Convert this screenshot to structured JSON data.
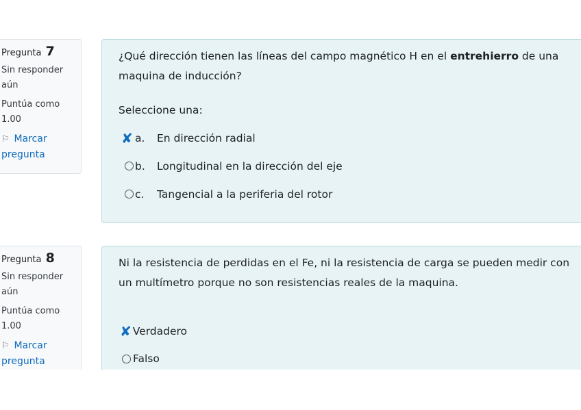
{
  "questions": [
    {
      "label": "Pregunta",
      "number": "7",
      "state": "Sin responder aún",
      "grade": "Puntúa como 1.00",
      "flag_label": "Marcar pregunta",
      "text_before": "¿Qué dirección tienen las líneas del campo magnético H en el ",
      "text_bold": "entrehierro",
      "text_after": " de una maquina de inducción?",
      "prompt": "Seleccione una:",
      "options": [
        {
          "letter": "a.",
          "text": "En dirección radial",
          "marked": true
        },
        {
          "letter": "b.",
          "text": "Longitudinal en la dirección del eje",
          "marked": false
        },
        {
          "letter": "c.",
          "text": "Tangencial a la periferia del rotor",
          "marked": false
        }
      ]
    },
    {
      "label": "Pregunta",
      "number": "8",
      "state": "Sin responder aún",
      "grade": "Puntúa como 1.00",
      "flag_label": "Marcar pregunta",
      "text": "Ni la resistencia de perdidas en el Fe, ni la resistencia de carga se pueden medir con un multímetro porque no son resistencias reales de la maquina.",
      "options": [
        {
          "text": "Verdadero",
          "marked": true
        },
        {
          "text": "Falso",
          "marked": false
        }
      ]
    }
  ],
  "icons": {
    "flag": "flag-icon",
    "cross_mark": "cross-mark-icon",
    "radio": "radio-icon"
  },
  "colors": {
    "link": "#0f6cbf",
    "panel_bg": "#e7f3f5",
    "panel_border": "#b8dce2",
    "info_bg": "#f8f9fa"
  }
}
